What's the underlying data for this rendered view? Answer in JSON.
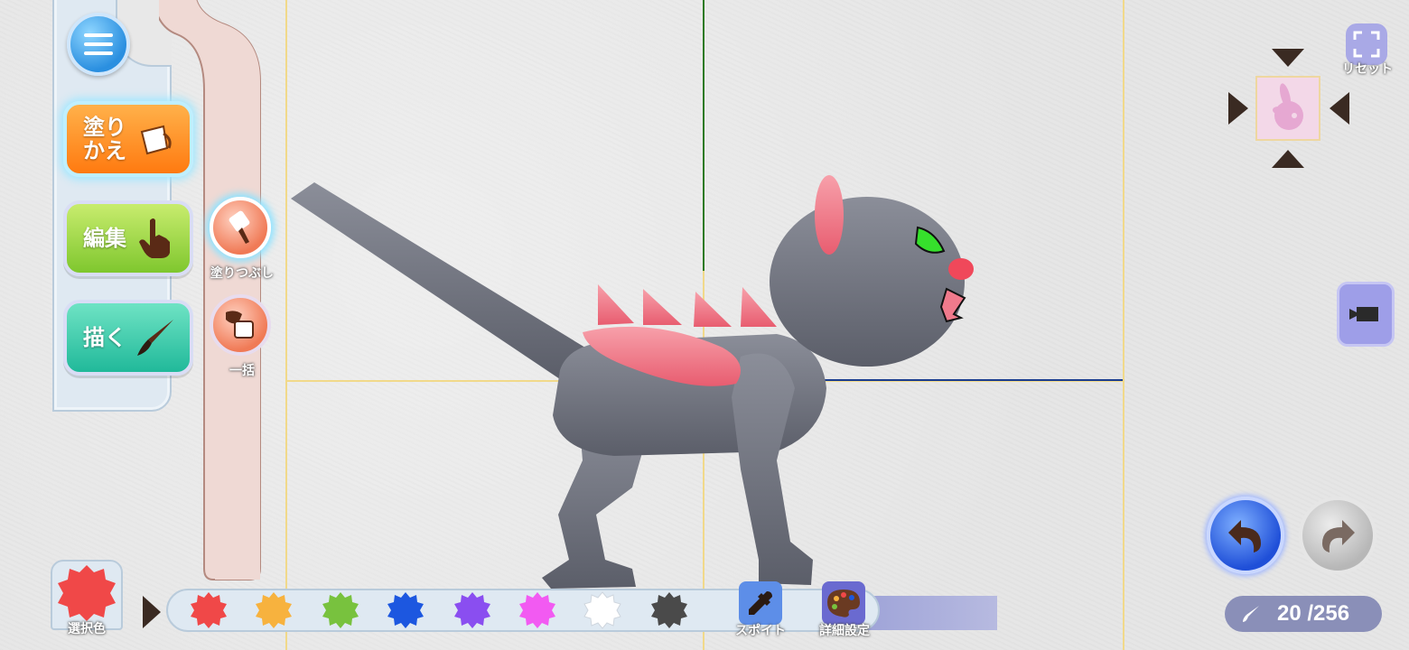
{
  "modes": {
    "recolor_label": "塗り\nかえ",
    "edit_label": "編集",
    "draw_label": "描く"
  },
  "tools": {
    "fill_label": "塗りつぶし",
    "bulk_label": "一括"
  },
  "camera": {
    "reset_label": "リセット"
  },
  "palette": {
    "selected_label": "選択色",
    "selected_color": "#f04848",
    "swatches": [
      {
        "name": "red",
        "color": "#f04848"
      },
      {
        "name": "orange",
        "color": "#f7b23e"
      },
      {
        "name": "green",
        "color": "#78c23e"
      },
      {
        "name": "blue",
        "color": "#1c57e0"
      },
      {
        "name": "purple",
        "color": "#8a4ef0"
      },
      {
        "name": "magenta",
        "color": "#f25af2"
      },
      {
        "name": "white",
        "color": "#ffffff"
      },
      {
        "name": "dark-gray",
        "color": "#4a4a4a"
      }
    ],
    "eyedropper_label": "スポイト",
    "advanced_label": "詳細設定"
  },
  "status": {
    "count": "20 /256"
  },
  "colors": {
    "creature_body": "#6b6e7a",
    "creature_accent": "#f07080",
    "guide_yellow": "#f1d98a",
    "guide_green": "#2d7a1e",
    "guide_blue": "#1a3d8f"
  }
}
